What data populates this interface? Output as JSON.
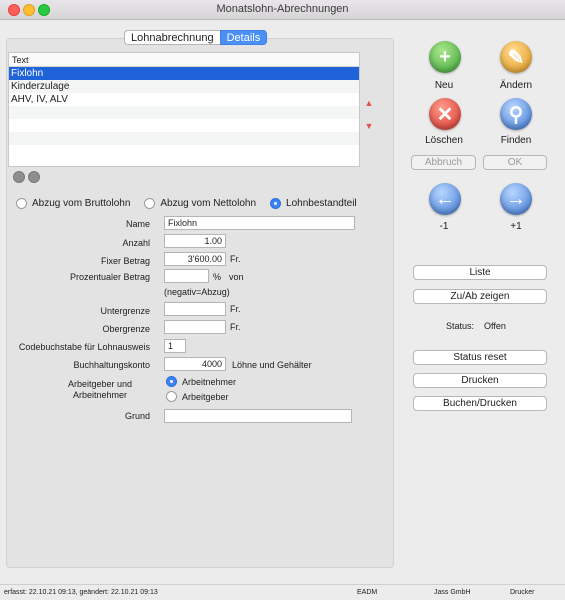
{
  "window": {
    "title": "Monatslohn-Abrechnungen"
  },
  "tabs": [
    "Lohnabrechnung",
    "Details"
  ],
  "list": {
    "header": "Text",
    "rows": [
      "Fixlohn",
      "Kinderzulage",
      "AHV, IV, ALV",
      "",
      "",
      "",
      ""
    ]
  },
  "arrows": {
    "up": "▲",
    "down": "▼"
  },
  "radio_group": {
    "options": [
      "Abzug vom Bruttolohn",
      "Abzug vom Nettolohn",
      "Lohnbestandteil"
    ],
    "selected": "Lohnbestandteil"
  },
  "form": {
    "name_label": "Name",
    "name_value": "Fixlohn",
    "anzahl_label": "Anzahl",
    "anzahl_value": "1.00",
    "fixer_label": "Fixer Betrag",
    "fixer_value": "3'600.00",
    "fixer_suffix": "Fr.",
    "prozent_label": "Prozentualer Betrag",
    "prozent_value": "",
    "prozent_suffix": "%",
    "prozent_von": "von",
    "prozent_note": "(negativ=Abzug)",
    "unter_label": "Untergrenze",
    "unter_value": "",
    "unter_suffix": "Fr.",
    "ober_label": "Obergrenze",
    "ober_value": "",
    "ober_suffix": "Fr.",
    "code_label": "Codebuchstabe für Lohnausweis",
    "code_value": "1",
    "konto_label": "Buchhaltungskonto",
    "konto_value": "4000",
    "konto_suffix": "Löhne und Gehälter",
    "arbeit_label_1": "Arbeitgeber und",
    "arbeit_label_2": "Arbeitnehmer",
    "arbeit_opt_1": "Arbeitnehmer",
    "arbeit_opt_2": "Arbeitgeber",
    "arbeit_selected": "Arbeitnehmer",
    "grund_label": "Grund",
    "grund_value": ""
  },
  "actions": {
    "neu": "Neu",
    "aendern": "Ändern",
    "loeschen": "Löschen",
    "finden": "Finden",
    "abbruch": "Abbruch",
    "ok": "OK",
    "prev": "-1",
    "next": "+1",
    "liste": "Liste",
    "zuab": "Zu/Ab zeigen",
    "status_label": "Status:",
    "status_value": "Offen",
    "status_reset": "Status reset",
    "drucken": "Drucken",
    "buchen": "Buchen/Drucken"
  },
  "statusbar": {
    "created": "erfasst: 22.10.21 09:13, geändert: 22.10.21 09:13",
    "user": "EADM",
    "company": "Jass GmbH",
    "printer": "Drucker"
  },
  "colors": {
    "accent": "#1f63d9",
    "tab_active": "#4a90f7"
  }
}
